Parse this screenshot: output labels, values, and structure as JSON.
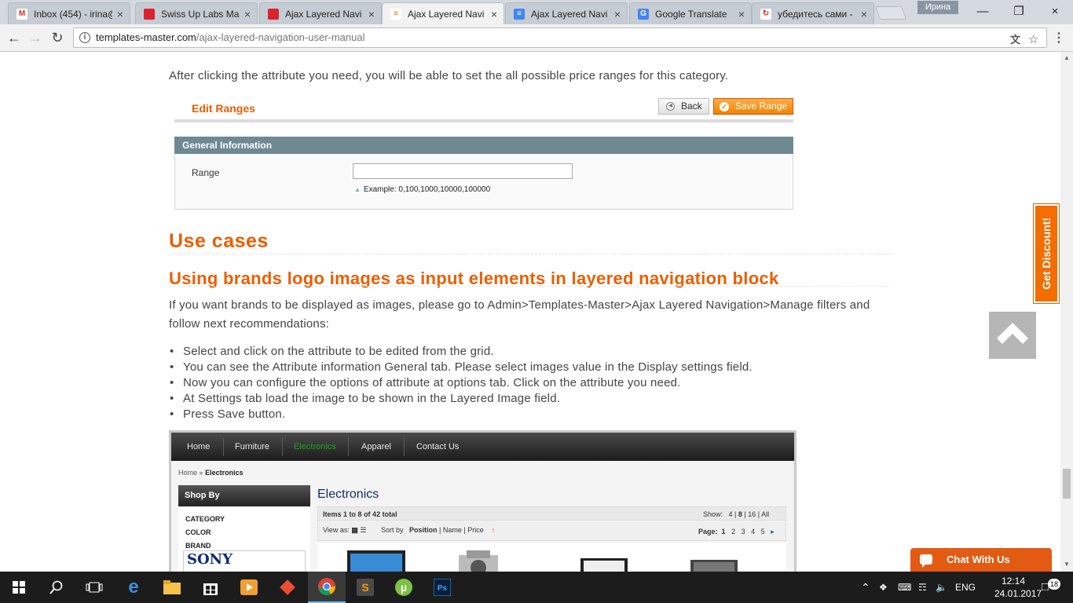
{
  "browser": {
    "tabs": [
      {
        "title": "Inbox (454) - irina@",
        "favicon_color": "#ffffff",
        "favicon_text": "M",
        "favicon_text_color": "#d93025"
      },
      {
        "title": "Swiss Up Labs Mag",
        "favicon_color": "#d9232e",
        "favicon_text": "",
        "favicon_text_color": "#ffffff"
      },
      {
        "title": "Ajax Layered Navi",
        "favicon_color": "#d9232e",
        "favicon_text": "",
        "favicon_text_color": "#ffffff"
      },
      {
        "title": "Ajax Layered Navi",
        "favicon_color": "#ffffff",
        "favicon_text": "≡",
        "favicon_text_color": "#e36c0a"
      },
      {
        "title": "Ajax Layered Navi",
        "favicon_color": "#4285f4",
        "favicon_text": "≡",
        "favicon_text_color": "#ffffff"
      },
      {
        "title": "Google Translate",
        "favicon_color": "#4285f4",
        "favicon_text": "G",
        "favicon_text_color": "#ffffff"
      },
      {
        "title": "убедитесь сами -",
        "favicon_color": "#ffffff",
        "favicon_text": "↻",
        "favicon_text_color": "#d93025"
      }
    ],
    "active_tab": 3,
    "profile_name": "Ирина",
    "url_host": "templates-master.com",
    "url_path": "/ajax-layered-navigation-user-manual",
    "close_glyph": "×"
  },
  "content": {
    "intro": "After clicking the attribute you need, you will be able to set the all possible price ranges for this category.",
    "edit_ranges": {
      "title": "Edit Ranges",
      "back_label": "Back",
      "save_label": "Save Range",
      "section_title": "General Information",
      "range_label": "Range",
      "range_value": "",
      "range_hint": "Example: 0,100,1000,10000,100000"
    },
    "use_cases_heading": "Use cases",
    "brands_heading": "Using brands logo images as input elements in layered navigation block",
    "brands_paragraph": "If you want brands to be displayed as images, please go to Admin>Templates-Master>Ajax Layered Navigation>Manage filters and follow next recommendations:",
    "steps": [
      "Select and click on the attribute to be edited from the grid.",
      "You can see the Attribute information General tab. Please select images value in the Display settings field.",
      "Now you can configure the options of attribute at options tab. Click on the attribute you need.",
      "At Settings tab load the image to be shown in the Layered Image field.",
      "Press Save button."
    ]
  },
  "store_screenshot": {
    "nav": [
      "Home",
      "Furniture",
      "Electronics",
      "Apparel",
      "Contact Us"
    ],
    "nav_current": 2,
    "breadcrumb_home": "Home",
    "breadcrumb_sep": "»",
    "breadcrumb_current": "Electronics",
    "shop_by": "Shop By",
    "filters": [
      "CATEGORY",
      "COLOR",
      "BRAND"
    ],
    "brand_logo": "SONY",
    "category_title": "Electronics",
    "items_label": "Items",
    "items_range": "1 to 8",
    "items_total": "of 42 total",
    "show_label": "Show:",
    "show_options": [
      "4",
      "8",
      "16",
      "All"
    ],
    "show_selected": "8",
    "view_as": "View as:",
    "sort_by": "Sort by",
    "sort_options": [
      "Position",
      "Name",
      "Price"
    ],
    "sort_selected": "Position",
    "page_label": "Page:",
    "pages": [
      "1",
      "2",
      "3",
      "4",
      "5"
    ],
    "page_current": "1",
    "next_page": "▸",
    "sort_dir": "↑"
  },
  "widgets": {
    "discount": "Get Discount!",
    "chat": "Chat With Us"
  },
  "taskbar": {
    "language": "ENG",
    "time": "12:14",
    "date": "24.01.2017",
    "notifications": "18"
  }
}
